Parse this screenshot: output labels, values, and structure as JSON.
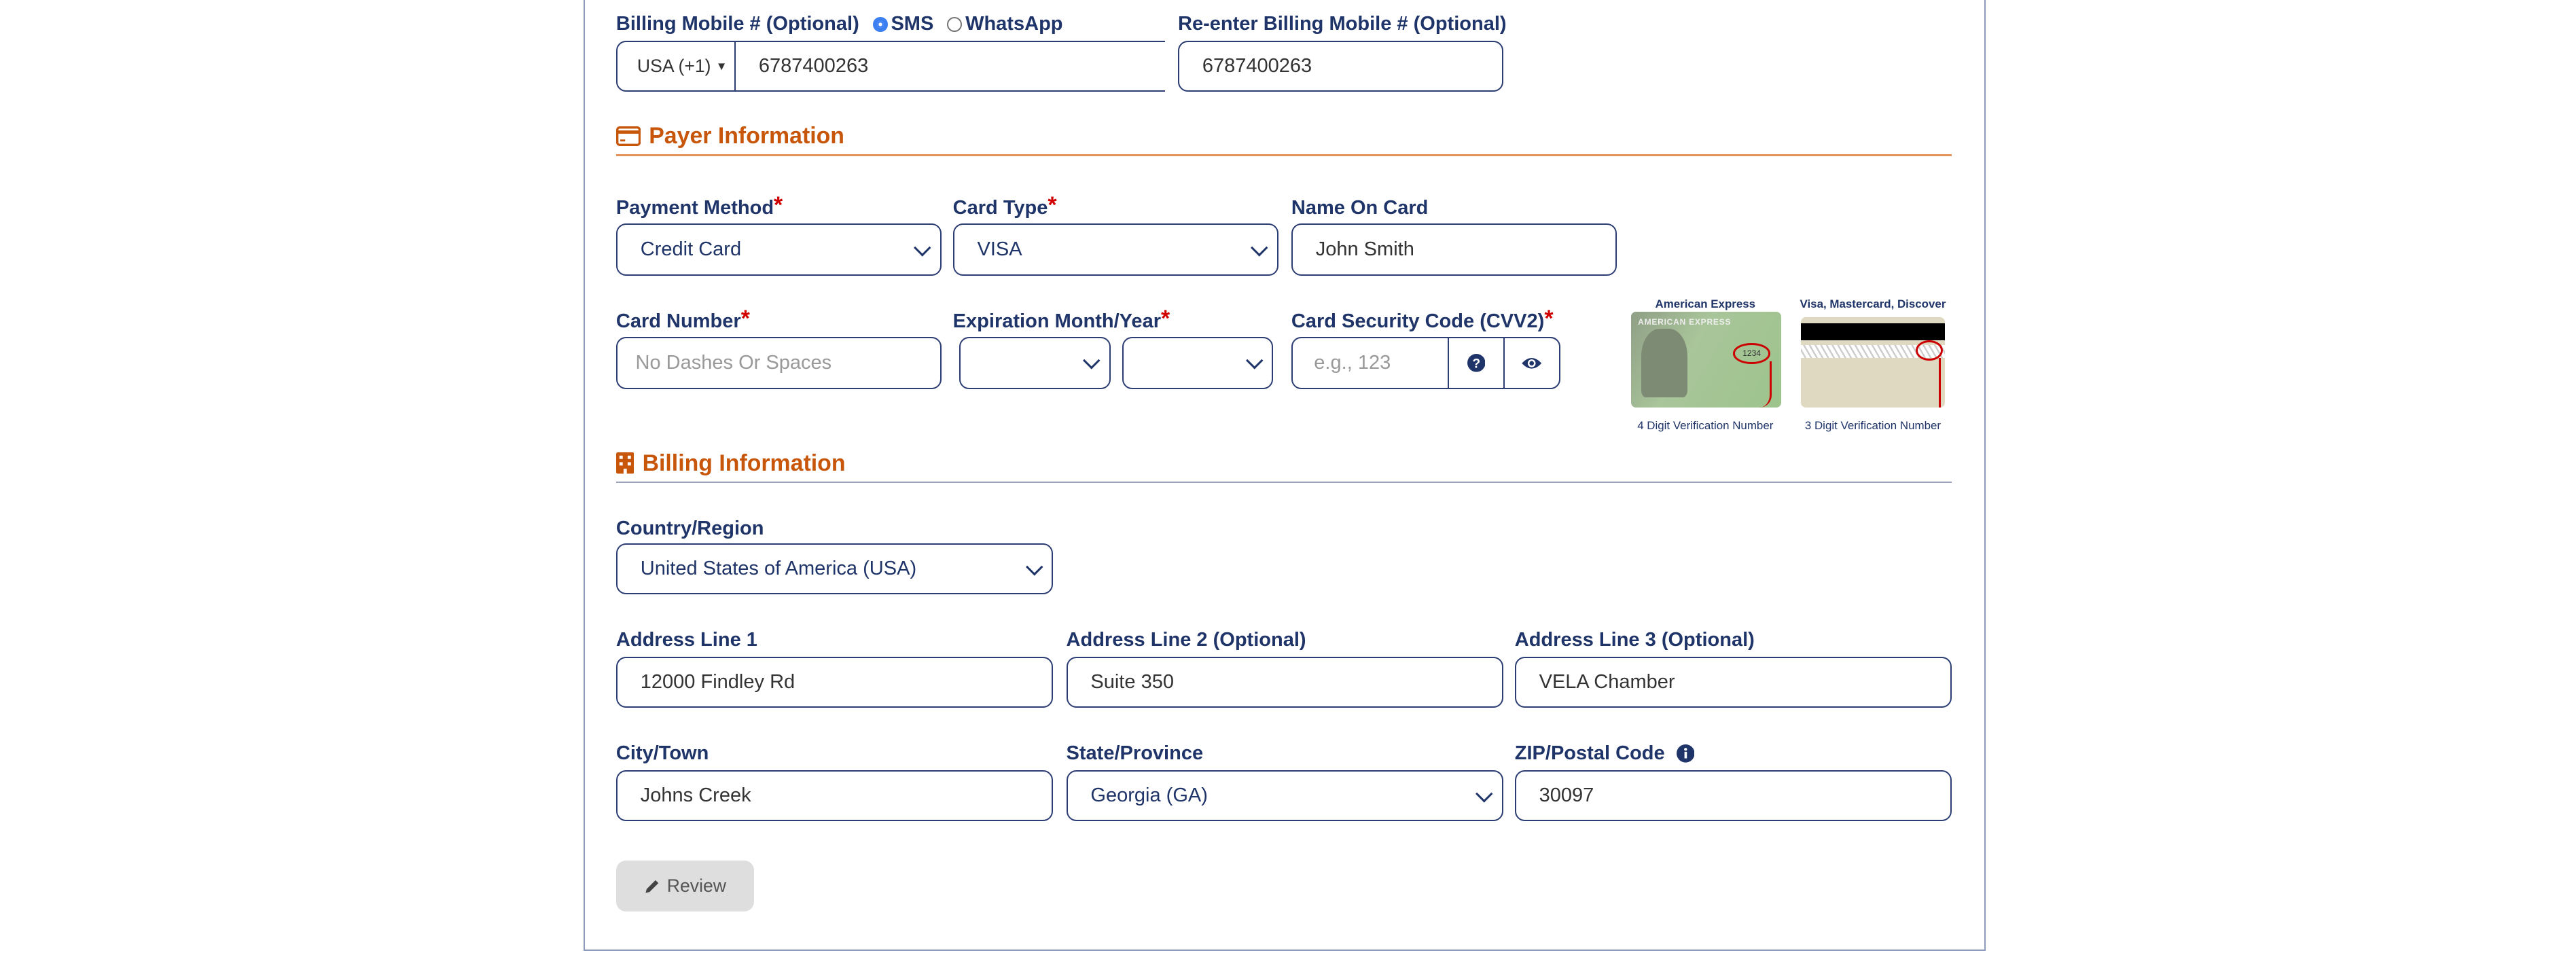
{
  "mobile": {
    "label": "Billing Mobile # (Optional)",
    "options": [
      "SMS",
      "WhatsApp"
    ],
    "selected": "SMS",
    "country_code": "USA (+1)",
    "value": "6787400263",
    "reenter_label": "Re-enter Billing Mobile # (Optional)",
    "reenter_value": "6787400263"
  },
  "payer": {
    "heading": "Payer Information",
    "payment_method_label": "Payment Method",
    "payment_method_value": "Credit Card",
    "card_type_label": "Card Type",
    "card_type_value": "VISA",
    "name_label": "Name On Card",
    "name_value": "John Smith",
    "card_number_label": "Card Number",
    "card_number_placeholder": "No Dashes Or Spaces",
    "expiration_label": "Expiration Month/Year",
    "cvv_label": "Card Security Code (CVV2)",
    "cvv_placeholder": "e.g., 123",
    "required_mark": "*",
    "amex_title": "American Express",
    "amex_caption": "4 Digit Verification Number",
    "amex_logo_text": "AMERICAN EXPRESS",
    "amex_code": "1234",
    "visa_title": "Visa, Mastercard, Discover",
    "visa_caption": "3 Digit Verification Number"
  },
  "billing": {
    "heading": "Billing Information",
    "country_label": "Country/Region",
    "country_value": "United States of America (USA)",
    "address1_label": "Address Line 1",
    "address1_value": "12000 Findley Rd",
    "address2_label": "Address Line 2 (Optional)",
    "address2_value": "Suite 350",
    "address3_label": "Address Line 3 (Optional)",
    "address3_value": "VELA Chamber",
    "city_label": "City/Town",
    "city_value": "Johns Creek",
    "state_label": "State/Province",
    "state_value": "Georgia (GA)",
    "zip_label": "ZIP/Postal Code",
    "zip_value": "30097"
  },
  "review_button": "Review",
  "colors": {
    "label": "#1f3468",
    "heading": "#c8560a",
    "required": "#d00000",
    "border": "#2b3d72"
  }
}
